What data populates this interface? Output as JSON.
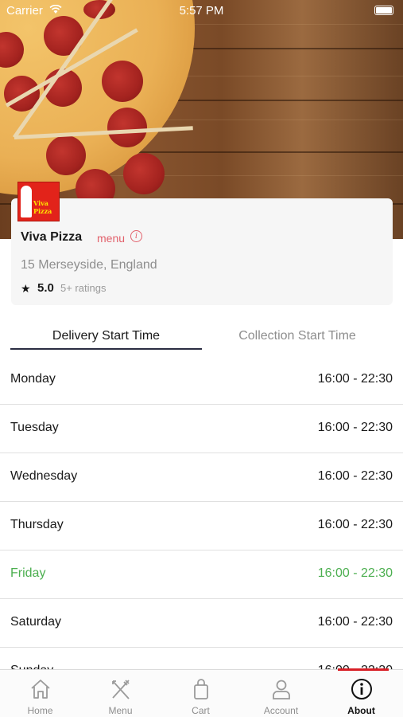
{
  "status_bar": {
    "carrier": "Carrier",
    "time": "5:57 PM"
  },
  "restaurant": {
    "logo_text": "Viva Pizza",
    "name": "Viva Pizza",
    "menu_label": "menu",
    "address": "15 Merseyside, England",
    "star": "★",
    "rating": "5.0",
    "rating_count": "5+ ratings"
  },
  "tabs": [
    {
      "label": "Delivery Start Time",
      "active": true
    },
    {
      "label": "Collection Start Time",
      "active": false
    }
  ],
  "hours": [
    {
      "day": "Monday",
      "time": "16:00 - 22:30"
    },
    {
      "day": "Tuesday",
      "time": "16:00 - 22:30"
    },
    {
      "day": "Wednesday",
      "time": "16:00 - 22:30"
    },
    {
      "day": "Thursday",
      "time": "16:00 - 22:30"
    },
    {
      "day": "Friday",
      "time": "16:00 - 22:30",
      "active": true
    },
    {
      "day": "Saturday",
      "time": "16:00 - 22:30"
    },
    {
      "day": "Sunday",
      "time": "16:00 - 22:30"
    }
  ],
  "bottom_nav": [
    {
      "label": "Home",
      "icon": "home-icon"
    },
    {
      "label": "Menu",
      "icon": "fork-knife-icon"
    },
    {
      "label": "Cart",
      "icon": "shopping-bag-icon"
    },
    {
      "label": "Account",
      "icon": "account-icon"
    },
    {
      "label": "About",
      "icon": "info-icon",
      "active": true
    }
  ],
  "colors": {
    "accent_red": "#d81f26",
    "menu_pink": "#e2606b",
    "active_green": "#4caf50",
    "tab_underline": "#2b2d42"
  }
}
